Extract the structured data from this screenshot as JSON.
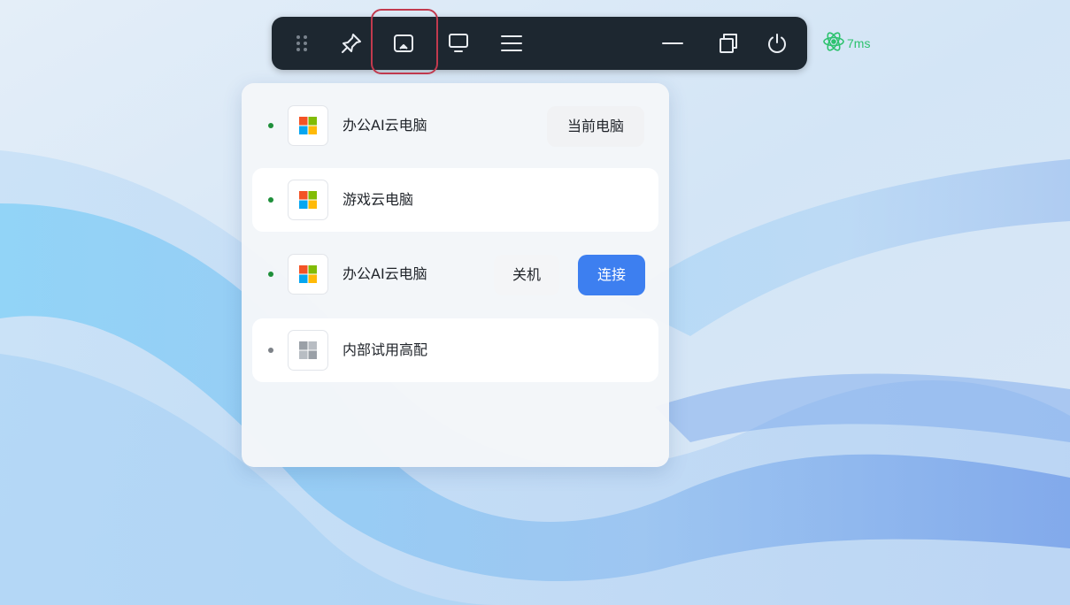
{
  "colors": {
    "toolbar_bg": "#1d2730",
    "highlight": "#c23a4e",
    "latency": "#2dc26e",
    "online_dot": "#1e8f3a",
    "offline_dot": "#7d8288",
    "primary": "#3d7ff0"
  },
  "toolbar": {
    "items": [
      {
        "name": "drag-handle-icon"
      },
      {
        "name": "pin-icon"
      },
      {
        "name": "cast-screen-icon"
      },
      {
        "name": "monitor-icon"
      },
      {
        "name": "menu-icon"
      },
      {
        "name": "atom-network-icon"
      },
      {
        "name": "minimize-icon"
      },
      {
        "name": "restore-window-icon"
      },
      {
        "name": "power-icon"
      }
    ],
    "latency": "7ms"
  },
  "computers": [
    {
      "name": "办公AI云电脑",
      "status": "online",
      "os_icon": "windows-color-icon",
      "action": "当前电脑"
    },
    {
      "name": "游戏云电脑",
      "status": "online",
      "os_icon": "windows-color-icon"
    },
    {
      "name": "办公AI云电脑",
      "status": "online",
      "os_icon": "windows-color-icon",
      "shutdown_label": "关机",
      "connect_label": "连接"
    },
    {
      "name": "内部试用高配",
      "status": "offline",
      "os_icon": "windows-gray-icon"
    }
  ]
}
